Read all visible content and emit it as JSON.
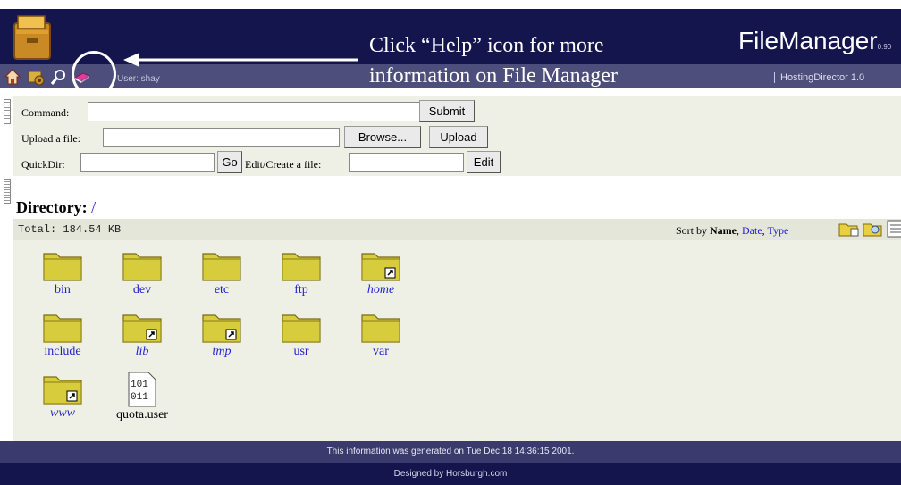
{
  "header": {
    "title": "FileManager",
    "version": "0.90",
    "user": "User: shay",
    "hosting": "HostingDirector 1.0",
    "annotation_line1": "Click “Help” icon for more",
    "annotation_line2": "information on File Manager",
    "toolbar_icons": [
      "home-icon",
      "settings-icon",
      "search-icon",
      "help-icon"
    ]
  },
  "commands": {
    "command_label": "Command:",
    "submit_label": "Submit",
    "upload_label": "Upload a file:",
    "browse_label": "Browse...",
    "upload_button": "Upload",
    "quickdir_label": "QuickDir:",
    "go_label": "Go",
    "edit_label": "Edit/Create a file:",
    "edit_button": "Edit"
  },
  "directory": {
    "heading": "Directory:",
    "path": "/",
    "total": "Total: 184.54 KB",
    "sort_by": "Sort by",
    "sort_name": "Name",
    "sort_date": "Date",
    "sort_type": "Type",
    "entries": [
      {
        "name": "bin",
        "kind": "folder",
        "link": false
      },
      {
        "name": "dev",
        "kind": "folder",
        "link": false
      },
      {
        "name": "etc",
        "kind": "folder",
        "link": false
      },
      {
        "name": "ftp",
        "kind": "folder",
        "link": false
      },
      {
        "name": "home",
        "kind": "folder",
        "link": true
      },
      {
        "name": "include",
        "kind": "folder",
        "link": false
      },
      {
        "name": "lib",
        "kind": "folder",
        "link": true
      },
      {
        "name": "tmp",
        "kind": "folder",
        "link": true
      },
      {
        "name": "usr",
        "kind": "folder",
        "link": false
      },
      {
        "name": "var",
        "kind": "folder",
        "link": false
      },
      {
        "name": "www",
        "kind": "folder",
        "link": true
      },
      {
        "name": "quota.user",
        "kind": "file",
        "link": false
      }
    ],
    "binary_icon_text": [
      "101",
      "011"
    ]
  },
  "footer": {
    "generated": "This information was generated on Tue Dec 18 14:36:15 2001.",
    "designed": "Designed by Horsburgh.com"
  },
  "colors": {
    "header_bg": "#15154e",
    "link": "#2222cc",
    "panel_bg": "#eef0e6",
    "folder": "#d7cc3c"
  }
}
